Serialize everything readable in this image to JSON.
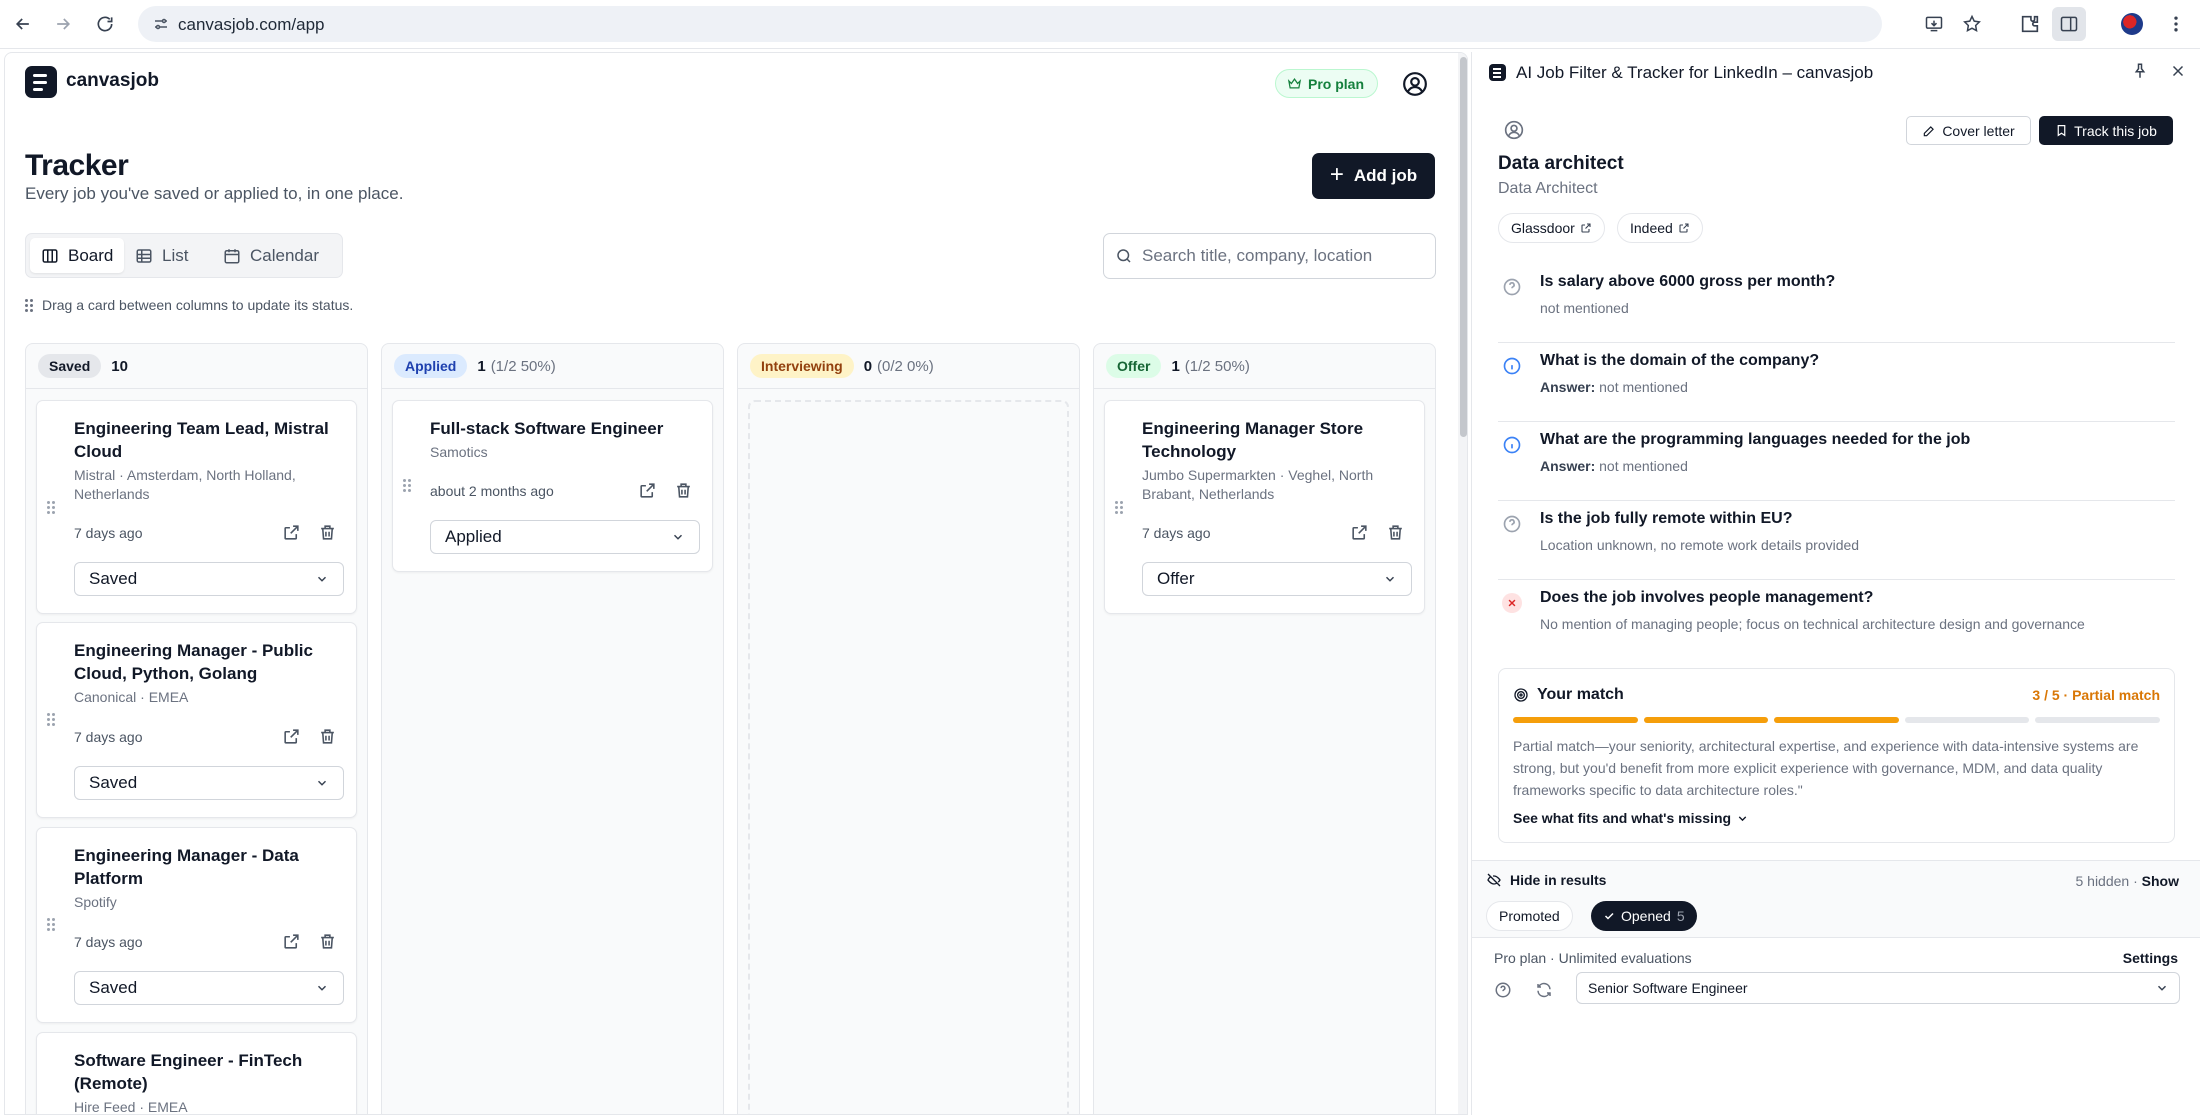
{
  "browser": {
    "url": "canvasjob.com/app"
  },
  "app": {
    "brand": "canvasjob",
    "plan_badge": "Pro plan",
    "title": "Tracker",
    "subtitle": "Every job you've saved or applied to, in one place.",
    "add_job_label": "Add job",
    "views": [
      "Board",
      "List",
      "Calendar"
    ],
    "active_view": "Board",
    "search_placeholder": "Search title, company, location",
    "hint": "Drag a card between columns to update its status.",
    "columns": [
      {
        "status": "Saved",
        "count": "10",
        "pct": "",
        "cards": [
          {
            "title": "Engineering Team Lead, Mistral Cloud",
            "company": "Mistral · Amsterdam, North Holland, Netherlands",
            "time": "7 days ago",
            "status": "Saved"
          },
          {
            "title": "Engineering Manager - Public Cloud, Python, Golang",
            "company": "Canonical · EMEA",
            "time": "7 days ago",
            "status": "Saved"
          },
          {
            "title": "Engineering Manager - Data Platform",
            "company": "Spotify",
            "time": "7 days ago",
            "status": "Saved"
          },
          {
            "title": "Software Engineer - FinTech (Remote)",
            "company": "Hire Feed · EMEA",
            "time": "",
            "status": ""
          }
        ]
      },
      {
        "status": "Applied",
        "count": "1",
        "pct": "(1/2 50%)",
        "cards": [
          {
            "title": "Full-stack Software Engineer",
            "company": "Samotics",
            "time": "about 2 months ago",
            "status": "Applied"
          }
        ]
      },
      {
        "status": "Interviewing",
        "count": "0",
        "pct": "(0/2 0%)",
        "cards": []
      },
      {
        "status": "Offer",
        "count": "1",
        "pct": "(1/2 50%)",
        "cards": [
          {
            "title": "Engineering Manager Store Technology",
            "company": "Jumbo Supermarkten · Veghel, North Brabant, Netherlands",
            "time": "7 days ago",
            "status": "Offer"
          }
        ]
      }
    ]
  },
  "panel": {
    "title": "AI Job Filter & Tracker for LinkedIn – canvasjob",
    "cover_letter_label": "Cover letter",
    "track_label": "Track this job",
    "job_title": "Data architect",
    "job_subtitle": "Data Architect",
    "links": [
      "Glassdoor",
      "Indeed"
    ],
    "questions": [
      {
        "q": "Is salary above 6000 gross per month?",
        "prefix": "",
        "a": "not mentioned",
        "icon": "help"
      },
      {
        "q": "What is the domain of the company?",
        "prefix": "Answer:",
        "a": "not mentioned",
        "icon": "info"
      },
      {
        "q": "What are the programming languages needed for the job",
        "prefix": "Answer:",
        "a": "not mentioned",
        "icon": "info"
      },
      {
        "q": "Is the job fully remote within EU?",
        "prefix": "",
        "a": "Location unknown, no remote work details provided",
        "icon": "help"
      },
      {
        "q": "Does the job involves people management?",
        "prefix": "",
        "a": "No mention of managing people; focus on technical architecture design and governance",
        "icon": "x"
      }
    ],
    "match": {
      "title": "Your match",
      "score_text": "3 / 5 · Partial match",
      "score": 3,
      "max": 5,
      "text": "Partial match—your seniority, architectural expertise, and experience with data-intensive systems are strong, but you'd benefit from more explicit experience with governance, MDM, and data quality frameworks specific to data architecture roles.\"",
      "more_label": "See what fits and what's missing"
    },
    "hide": {
      "label": "Hide in results",
      "hidden_text": "5 hidden ·",
      "show_label": "Show",
      "filters": [
        {
          "label": "Promoted",
          "count": "",
          "active": false
        },
        {
          "label": "Opened",
          "count": "5",
          "active": true
        }
      ]
    },
    "plan_line": "Pro plan · Unlimited evaluations",
    "settings_label": "Settings",
    "profile_select": "Senior Software Engineer"
  },
  "colors": {
    "accent_dark": "#111827",
    "saved_pill": "#e5e7eb",
    "applied_pill": "#dbeafe",
    "interviewing_pill": "#fef3c7",
    "offer_pill": "#dcfce7",
    "match_bar": "#f59e0b"
  }
}
